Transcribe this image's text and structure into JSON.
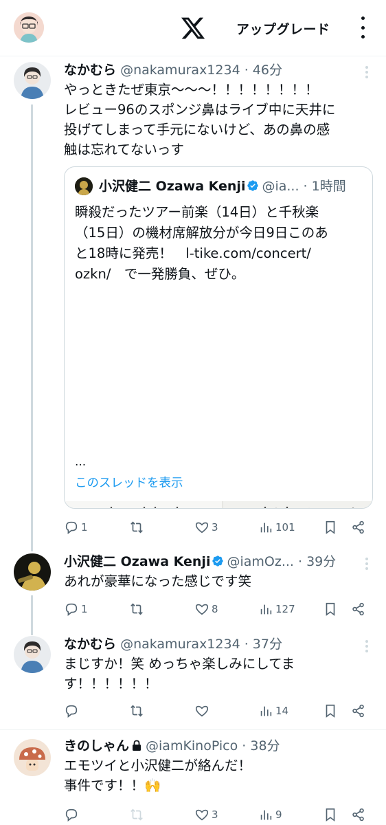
{
  "header": {
    "upgrade_label": "アップグレード"
  },
  "tweets": [
    {
      "name": "なかむら",
      "meta": "@nakamurax1234 · 46分",
      "lines": [
        "やっときたぜ東京〜〜〜！！！！！！！！",
        "レビュー96のスポンジ鼻はライブ中に天井に",
        "投げてしまって手元にないけど、あの鼻の感",
        "触は忘れてないっす"
      ],
      "actions": {
        "reply": "1",
        "retweet": "",
        "like": "3",
        "views": "101"
      }
    },
    {
      "name": "小沢健二 Ozawa Kenji",
      "meta": "@iamOz... · 39分",
      "lines": [
        "あれが豪華になった感じです笑"
      ],
      "actions": {
        "reply": "1",
        "retweet": "",
        "like": "8",
        "views": "127"
      }
    },
    {
      "name": "なかむら",
      "meta": "@nakamurax1234 · 37分",
      "lines": [
        "まじすか！笑 めっちゃ楽しみにしてま",
        "す！！！！！！"
      ],
      "actions": {
        "reply": "",
        "retweet": "",
        "like": "",
        "views": "14"
      }
    },
    {
      "name": "きのしゃん",
      "meta": "@iamKinoPico · 38分",
      "lines": [
        "エモツイと小沢健二が絡んだ！",
        "事件です！！🙌"
      ],
      "actions": {
        "reply": "",
        "retweet": "",
        "like": "3",
        "views": "9"
      }
    }
  ],
  "quote": {
    "name": "小沢健二 Ozawa Kenji",
    "meta": "@ia... · 1時間",
    "lines": [
      "瞬殺だったツアー前楽（14日）と千秋楽",
      "（15日）の機材席解放分が今日9日このあ",
      "と18時に発売！　l-tike.com/concert/",
      "ozkn/　で一発勝負、ぜひ。"
    ],
    "more": "...",
    "show_thread": "このスレッドを表示"
  }
}
